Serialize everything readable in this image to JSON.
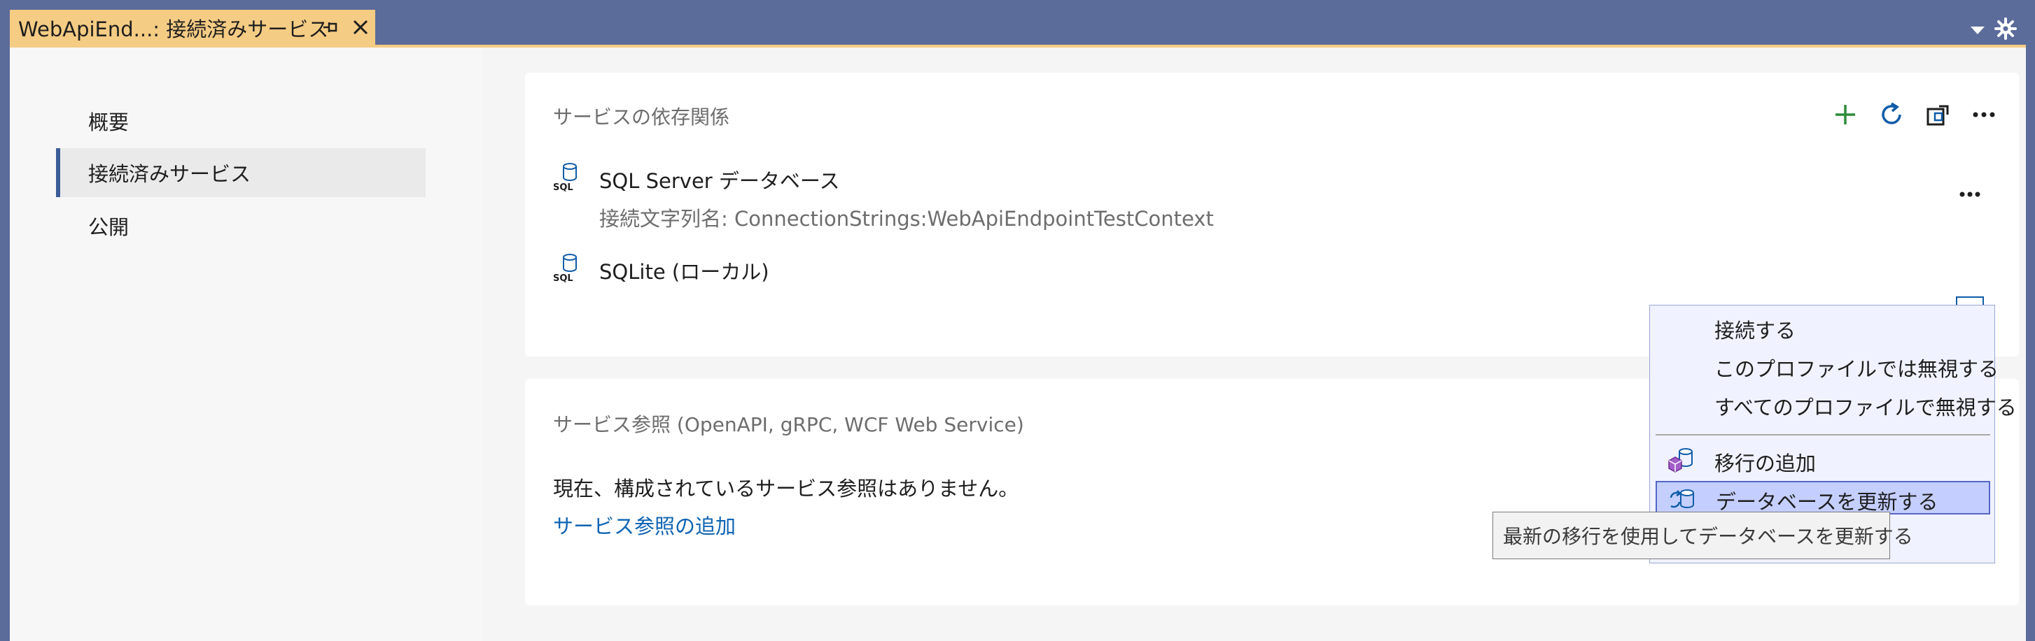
{
  "tab": {
    "title": "WebApiEnd...: 接続済みサービス"
  },
  "nav": {
    "items": [
      {
        "label": "概要"
      },
      {
        "label": "接続済みサービス"
      },
      {
        "label": "公開"
      }
    ]
  },
  "dependencies": {
    "title": "サービスの依存関係",
    "services": [
      {
        "name": "SQL Server データベース",
        "subtitle": "接続文字列名: ConnectionStrings:WebApiEndpointTestContext",
        "icon": "sql-database-icon"
      },
      {
        "name": "SQLite (ローカル)",
        "icon": "sql-database-icon"
      }
    ],
    "toolbar_icons": [
      "add-icon",
      "refresh-icon",
      "restore-icon",
      "more-icon"
    ]
  },
  "references": {
    "title": "サービス参照 (OpenAPI, gRPC, WCF Web Service)",
    "empty_text": "現在、構成されているサービス参照はありません。",
    "add_link": "サービス参照の追加"
  },
  "context_menu": {
    "items": [
      {
        "label": "接続する"
      },
      {
        "label": "このプロファイルでは無視する"
      },
      {
        "label": "すべてのプロファイルで無視する"
      },
      {
        "label": "移行の追加",
        "icon": "add-migration-icon"
      },
      {
        "label": "データベースを更新する",
        "icon": "update-database-icon",
        "highlighted": true
      }
    ]
  },
  "tooltip": {
    "text": "最新の移行を使用してデータベースを更新する"
  },
  "colors": {
    "tab_active": "#f5cc84",
    "frame": "#5b6b9a",
    "accent": "#0d63b3",
    "menu_highlight": "#c4cfff"
  }
}
